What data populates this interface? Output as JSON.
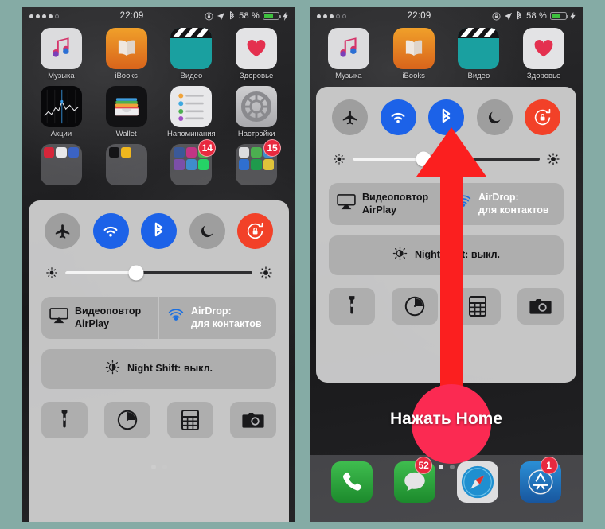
{
  "background_color": "#85aba5",
  "annotation": {
    "callout_text": "Нажать Home",
    "arrow_color": "#fb1f1f",
    "hotspot_color": "#fb2a52",
    "arrow_target": "bluetooth-toggle"
  },
  "panels": [
    {
      "id": "left",
      "status_bar": {
        "signal_dots_filled": 4,
        "signal_dots_total": 5,
        "clock": "22:09",
        "battery_percent": "58 %",
        "battery_fill": 62,
        "icons": [
          "rotation-lock-icon",
          "location-arrow-icon",
          "bluetooth-icon",
          "battery-icon",
          "charging-bolt-icon"
        ]
      },
      "apps": [
        {
          "label": "Музыка",
          "icon": "music-icon",
          "badge": ""
        },
        {
          "label": "iBooks",
          "icon": "ibooks-icon",
          "badge": ""
        },
        {
          "label": "Видео",
          "icon": "videos-icon",
          "badge": ""
        },
        {
          "label": "Здоровье",
          "icon": "health-icon",
          "badge": ""
        },
        {
          "label": "Акции",
          "icon": "stocks-icon",
          "badge": ""
        },
        {
          "label": "Wallet",
          "icon": "wallet-icon",
          "badge": ""
        },
        {
          "label": "Напоминания",
          "icon": "reminders-icon",
          "badge": ""
        },
        {
          "label": "Настройки",
          "icon": "settings-icon",
          "badge": ""
        }
      ],
      "folders": [
        {
          "badge": "",
          "icon": "folder-icon"
        },
        {
          "badge": "",
          "icon": "folder-icon"
        },
        {
          "badge": "14",
          "icon": "folder-icon"
        },
        {
          "badge": "15",
          "icon": "folder-icon"
        }
      ],
      "page_dots": {
        "total": 2,
        "active": 0
      },
      "control_center": {
        "visible": true,
        "toggles": [
          {
            "name": "airplane-mode-toggle",
            "icon": "airplane-icon",
            "state": "off",
            "color": "#9e9e9e"
          },
          {
            "name": "wifi-toggle",
            "icon": "wifi-icon",
            "state": "on",
            "color": "#1c62e8"
          },
          {
            "name": "bluetooth-toggle",
            "icon": "bluetooth-icon",
            "state": "on",
            "color": "#1c62e8"
          },
          {
            "name": "do-not-disturb-toggle",
            "icon": "moon-icon",
            "state": "off",
            "color": "#9e9e9e"
          },
          {
            "name": "rotation-lock-toggle",
            "icon": "rotation-lock-icon",
            "state": "on",
            "color": "#f24128"
          }
        ],
        "brightness": {
          "value": 38,
          "low_icon": "sun-small-icon",
          "high_icon": "sun-large-icon"
        },
        "airplay_label_line1": "Видеоповтор",
        "airplay_label_line2": "AirPlay",
        "airdrop_label_line1": "AirDrop:",
        "airdrop_label_line2": "для контактов",
        "night_shift_label": "Night Shift: выкл.",
        "shortcuts": [
          {
            "name": "flashlight-button",
            "icon": "flashlight-icon"
          },
          {
            "name": "timer-button",
            "icon": "timer-icon"
          },
          {
            "name": "calculator-button",
            "icon": "calculator-icon"
          },
          {
            "name": "camera-button",
            "icon": "camera-icon"
          }
        ]
      },
      "dock": []
    },
    {
      "id": "right",
      "status_bar": {
        "signal_dots_filled": 3,
        "signal_dots_total": 5,
        "clock": "22:09",
        "battery_percent": "58 %",
        "battery_fill": 62,
        "icons": [
          "rotation-lock-icon",
          "location-arrow-icon",
          "bluetooth-icon",
          "battery-icon",
          "charging-bolt-icon"
        ]
      },
      "apps": [
        {
          "label": "Музыка",
          "icon": "music-icon",
          "badge": ""
        },
        {
          "label": "iBooks",
          "icon": "ibooks-icon",
          "badge": ""
        },
        {
          "label": "Видео",
          "icon": "videos-icon",
          "badge": ""
        },
        {
          "label": "Здоровье",
          "icon": "health-icon",
          "badge": ""
        }
      ],
      "folders": [],
      "page_dots": {
        "total": 2,
        "active": 0
      },
      "control_center": {
        "visible": true,
        "toggles": [
          {
            "name": "airplane-mode-toggle",
            "icon": "airplane-icon",
            "state": "off",
            "color": "#9e9e9e"
          },
          {
            "name": "wifi-toggle",
            "icon": "wifi-icon",
            "state": "on",
            "color": "#1c62e8"
          },
          {
            "name": "bluetooth-toggle",
            "icon": "bluetooth-icon",
            "state": "on",
            "color": "#1c62e8"
          },
          {
            "name": "do-not-disturb-toggle",
            "icon": "moon-icon",
            "state": "off",
            "color": "#9e9e9e"
          },
          {
            "name": "rotation-lock-toggle",
            "icon": "rotation-lock-icon",
            "state": "on",
            "color": "#f24128"
          }
        ],
        "brightness": {
          "value": 38,
          "low_icon": "sun-small-icon",
          "high_icon": "sun-large-icon"
        },
        "airplay_label_line1": "Видеоповтор",
        "airplay_label_line2": "AirPlay",
        "airdrop_label_line1": "AirDrop:",
        "airdrop_label_line2": "для контактов",
        "night_shift_label": "Night Shift: выкл.",
        "shortcuts": [
          {
            "name": "flashlight-button",
            "icon": "flashlight-icon"
          },
          {
            "name": "timer-button",
            "icon": "timer-icon"
          },
          {
            "name": "calculator-button",
            "icon": "calculator-icon"
          },
          {
            "name": "camera-button",
            "icon": "camera-icon"
          }
        ]
      },
      "dock": [
        {
          "name": "phone-app",
          "icon": "phone-icon",
          "badge": ""
        },
        {
          "name": "messages-app",
          "icon": "messages-icon",
          "badge": "52"
        },
        {
          "name": "safari-app",
          "icon": "safari-icon",
          "badge": ""
        },
        {
          "name": "appstore-app",
          "icon": "appstore-icon",
          "badge": "1"
        }
      ]
    }
  ]
}
